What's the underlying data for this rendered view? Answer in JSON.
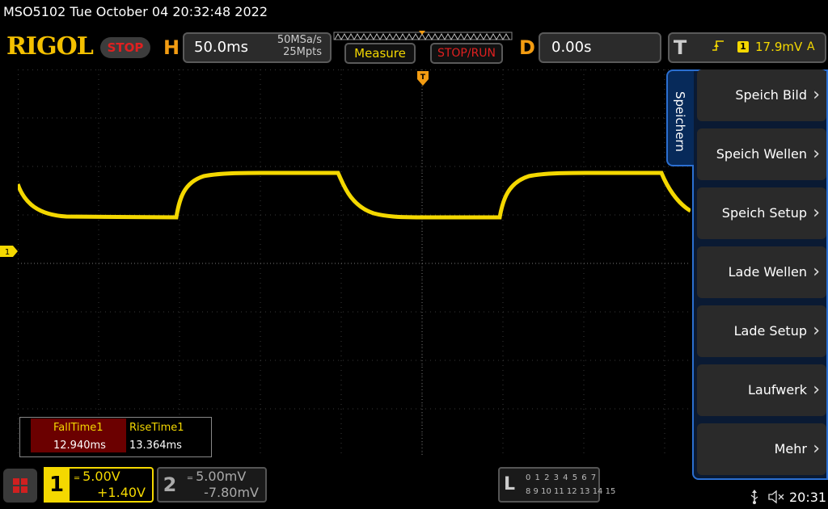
{
  "header": {
    "title": "MSO5102  Tue October 04 20:32:48 2022",
    "logo": "RIGOL",
    "status": "STOP"
  },
  "horizontal": {
    "letter": "H",
    "timebase": "50.0ms",
    "sample_rate": "50MSa/s",
    "memory_depth": "25Mpts"
  },
  "buttons": {
    "measure": "Measure",
    "stop_run": "STOP/RUN"
  },
  "delay": {
    "letter": "D",
    "value": "0.00s"
  },
  "trigger": {
    "letter": "T",
    "edge_icon": "rising-edge-icon",
    "source": "1",
    "level": "17.9mV",
    "mode": "A"
  },
  "channel_marker": "1",
  "measurements": {
    "fall_label": "FallTime1",
    "fall_value": "12.940ms",
    "rise_label": "RiseTime1",
    "rise_value": "13.364ms"
  },
  "menu": {
    "tab_label": "Speichern",
    "items": [
      "Speich Bild",
      "Speich Wellen",
      "Speich Setup",
      "Lade Wellen",
      "Lade Setup",
      "Laufwerk",
      "Mehr"
    ]
  },
  "channels": [
    {
      "number": "1",
      "coupling_icon": "dc-coupling-icon",
      "scale": "5.00V",
      "offset": "+1.40V",
      "color": "#f4d800"
    },
    {
      "number": "2",
      "coupling_icon": "dc-coupling-icon",
      "scale": "5.00mV",
      "offset": "-7.80mV",
      "color": "#aaaaaa"
    }
  ],
  "logic": {
    "letter": "L",
    "row1": "0 1 2 3   4 5 6 7",
    "row2": "8 9 10 11 12 13 14 15"
  },
  "status_bar": {
    "usb_icon": "usb-icon",
    "speaker_icon": "speaker-muted-icon",
    "time": "20:31"
  },
  "colors": {
    "waveform": "#f4d800",
    "accent": "#f39c12",
    "menu_border": "#2b6fd1",
    "stop": "#e02020"
  }
}
